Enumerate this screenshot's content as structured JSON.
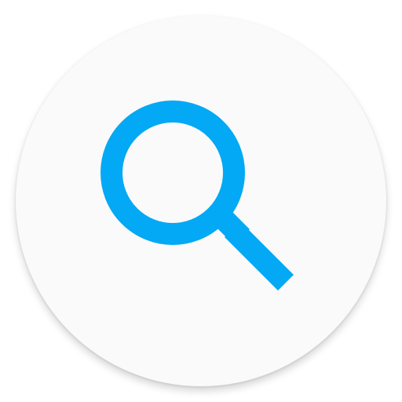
{
  "app_icon": {
    "icon": "search-icon",
    "background_color": "#fafafa",
    "accent_color": "#03a9f4"
  }
}
